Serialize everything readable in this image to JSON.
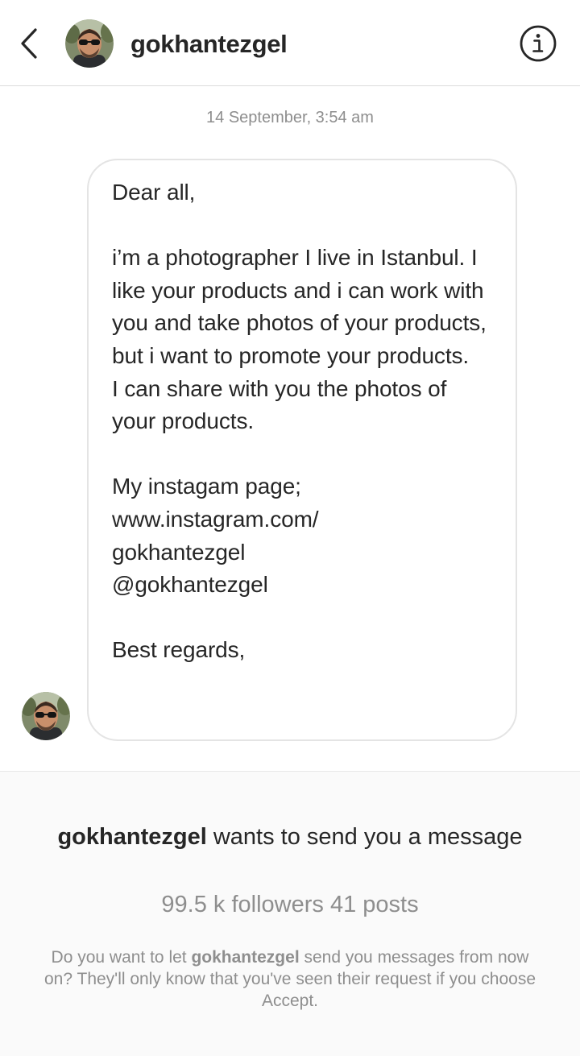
{
  "header": {
    "username": "gokhantezgel",
    "back_icon": "chevron-left-icon",
    "info_icon": "info-circle-icon"
  },
  "timestamp": "14 September, 3:54 am",
  "message": {
    "text": "Dear all,\n\ni’m a photographer I live in Istanbul. I like your products and i can work with you and take photos of your products, but i want to promote your products.\nI can share with you the photos of your products.\n\nMy instagam page;\nwww.instagram.com/\ngokhantezgel\n@gokhantezgel\n\nBest regards,"
  },
  "request": {
    "username": "gokhantezgel",
    "title_suffix": "wants to send you a message",
    "stats": "99.5 k followers 41 posts",
    "note_prefix": "Do you want to let",
    "note_username": "gokhantezgel",
    "note_suffix": "send you messages from now on? They'll only know that you've seen their request if you choose Accept."
  },
  "colors": {
    "text_primary": "#262626",
    "text_secondary": "#8e8e8e",
    "border": "#dbdbdb",
    "panel_background": "#fafafa"
  }
}
